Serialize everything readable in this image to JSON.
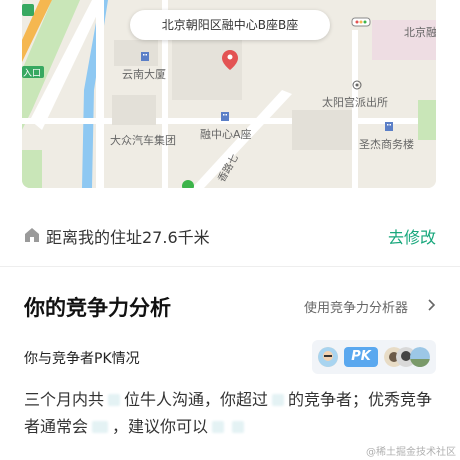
{
  "map": {
    "title": "北京朝阳区融中心B座B座",
    "labels": {
      "yunnan": "云南大厦",
      "dazhong": "大众汽车集团",
      "rongzhong_a": "融中心A座",
      "taiyanggong": "太阳宫派出所",
      "shengjie": "圣杰商务楼",
      "beijing_corner": "北京融",
      "entrance": "入口",
      "road": "香路七"
    },
    "colors": {
      "river": "#8ec8f2",
      "green": "#b7e3a8",
      "road_main": "#f5b750"
    }
  },
  "distance": {
    "text": "距离我的住址27.6千米",
    "edit_label": "去修改"
  },
  "competition": {
    "title": "你的竞争力分析",
    "analyzer_label": "使用竞争力分析器",
    "pk_title": "你与竞争者PK情况",
    "pk_badge": "PK",
    "desc_1": "三个月内共",
    "desc_2": "位牛人沟通，你超过",
    "desc_3": "的竞争者；优秀竞争者通常会",
    "desc_4": "，建议你可以",
    "accent": "#18a77c"
  },
  "watermark": "@稀土掘金技术社区"
}
